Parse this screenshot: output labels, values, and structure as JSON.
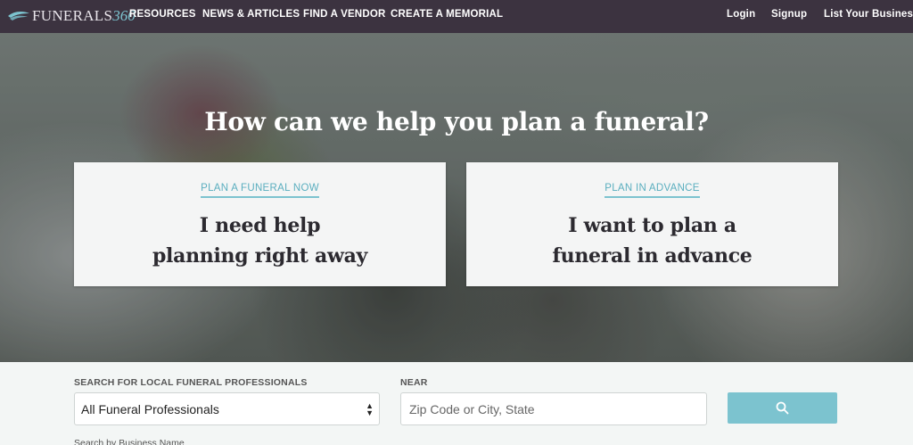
{
  "nav": {
    "logo_text": "FUNERALS",
    "logo_number": "360",
    "links": [
      "RESOURCES",
      "NEWS & ARTICLES",
      "FIND A VENDOR",
      "CREATE A MEMORIAL"
    ],
    "right_links": [
      "Login",
      "Signup",
      "List Your Business"
    ]
  },
  "hero": {
    "title": "How can we help you plan a funeral?",
    "cards": [
      {
        "eyebrow": "PLAN A FUNERAL NOW",
        "line1": "I need help",
        "line2": "planning right away"
      },
      {
        "eyebrow": "PLAN IN ADVANCE",
        "line1": "I want to plan a",
        "line2": "funeral in advance"
      }
    ]
  },
  "search": {
    "category_label": "SEARCH FOR LOCAL FUNERAL PROFESSIONALS",
    "category_value": "All Funeral Professionals",
    "near_label": "NEAR",
    "near_placeholder": "Zip Code or City, State",
    "business_name_link": "Search by Business Name"
  },
  "colors": {
    "nav_bg": "#3c3340",
    "accent": "#7cc3cf",
    "card_bg": "#f4f5f5",
    "search_bg": "#f3f6f5"
  },
  "icons": {
    "logo": "wing-logo-icon",
    "search_button": "search-icon",
    "select_arrows": "updown-arrows-icon"
  }
}
